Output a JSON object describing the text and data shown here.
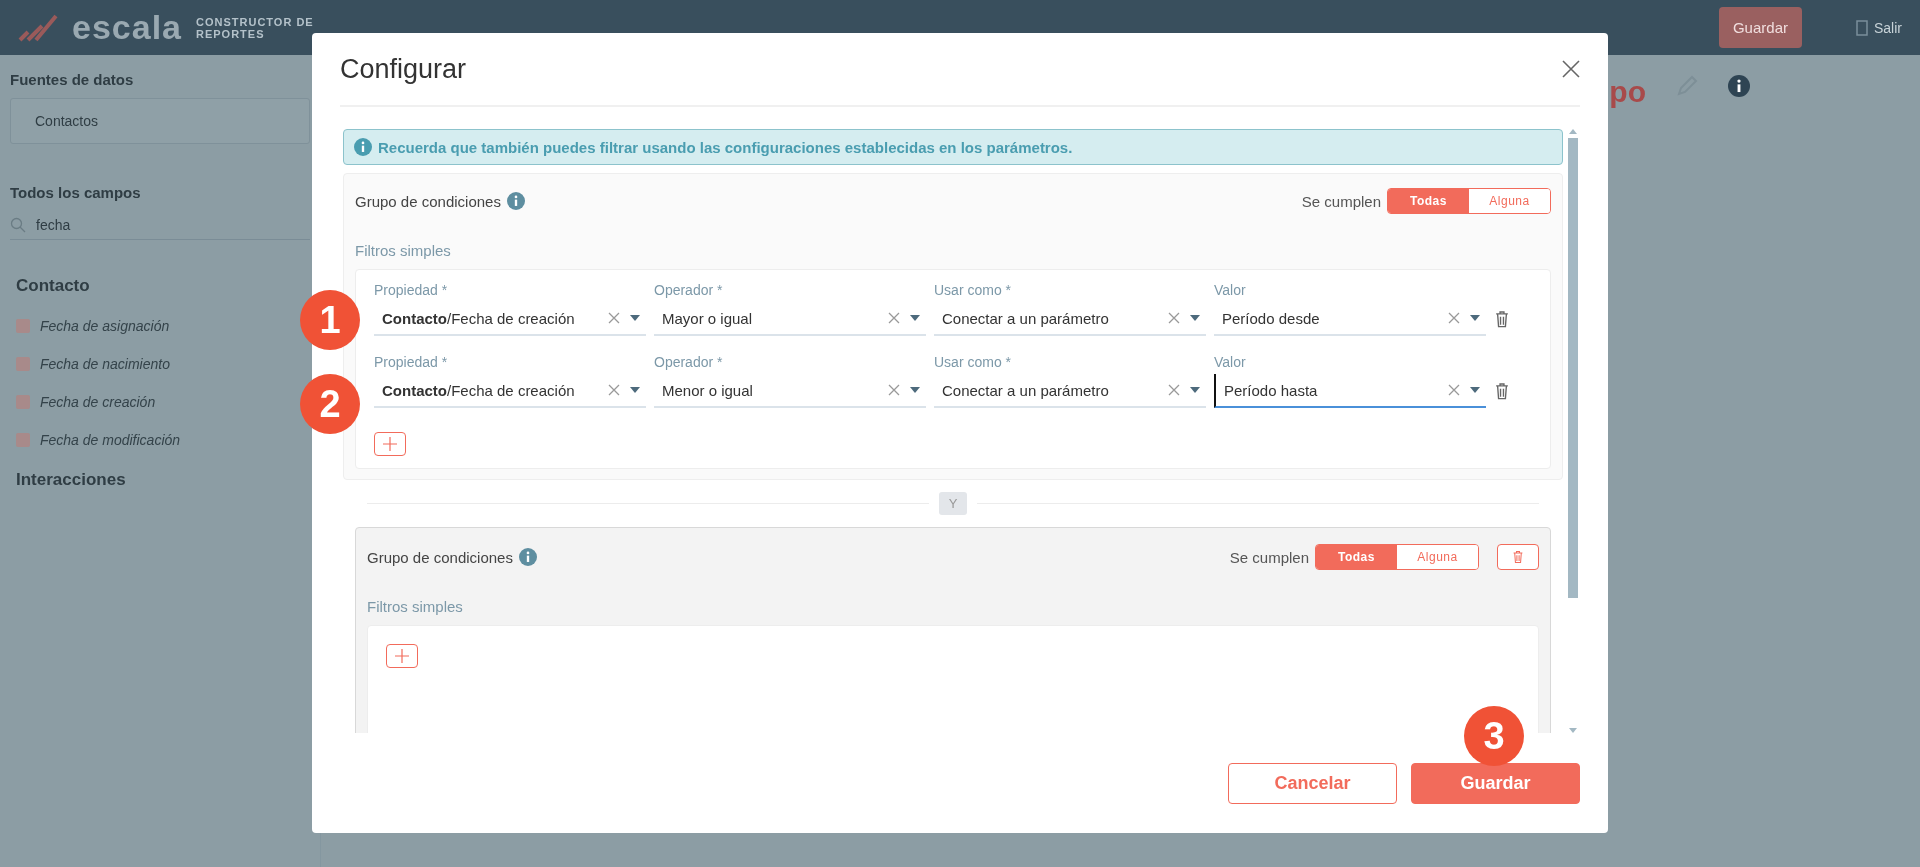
{
  "app": {
    "logo": "escala",
    "subtitle": "CONSTRUCTOR DE REPORTES",
    "save_button": "Guardar",
    "exit_button": "Salir",
    "title_fragment": "po"
  },
  "sidebar": {
    "sources_label": "Fuentes de datos",
    "source": "Contactos",
    "fields_label": "Todos los campos",
    "search_value": "fecha",
    "sections": [
      {
        "title": "Contacto",
        "fields": [
          "Fecha de asignación",
          "Fecha de nacimiento",
          "Fecha de creación",
          "Fecha de modificación"
        ]
      },
      {
        "title": "Interacciones"
      }
    ]
  },
  "dialog": {
    "title": "Configurar",
    "info": "Recuerda que también puedes filtrar usando las configuraciones establecidas en los parámetros.",
    "groups": [
      {
        "title": "Grupo de condiciones",
        "match_label": "Se cumplen",
        "deletable": false,
        "options": [
          {
            "label": "Todas",
            "selected": true
          },
          {
            "label": "Alguna",
            "selected": false
          }
        ],
        "filters_label": "Filtros simples",
        "filters": [
          {
            "fields": [
              {
                "label": "Propiedad *",
                "value": "**Contacto**/Fecha de creación",
                "focused": false
              },
              {
                "label": "Operador *",
                "value": "Mayor o igual",
                "focused": false
              },
              {
                "label": "Usar como *",
                "value": "Conectar a un parámetro",
                "focused": false
              },
              {
                "label": "Valor",
                "value": "Período desde",
                "focused": false
              }
            ]
          },
          {
            "fields": [
              {
                "label": "Propiedad *",
                "value": "**Contacto**/Fecha de creación",
                "focused": false
              },
              {
                "label": "Operador *",
                "value": "Menor o igual",
                "focused": false
              },
              {
                "label": "Usar como *",
                "value": "Conectar a un parámetro",
                "focused": false
              },
              {
                "label": "Valor",
                "value": "Período hasta",
                "focused": true
              }
            ]
          }
        ]
      },
      {
        "title": "Grupo de condiciones",
        "match_label": "Se cumplen",
        "deletable": true,
        "options": [
          {
            "label": "Todas",
            "selected": true
          },
          {
            "label": "Alguna",
            "selected": false
          }
        ],
        "filters_label": "Filtros simples"
      }
    ],
    "connector": "Y",
    "cancel": "Cancelar",
    "save": "Guardar"
  },
  "annotations": [
    "1",
    "2",
    "3"
  ]
}
